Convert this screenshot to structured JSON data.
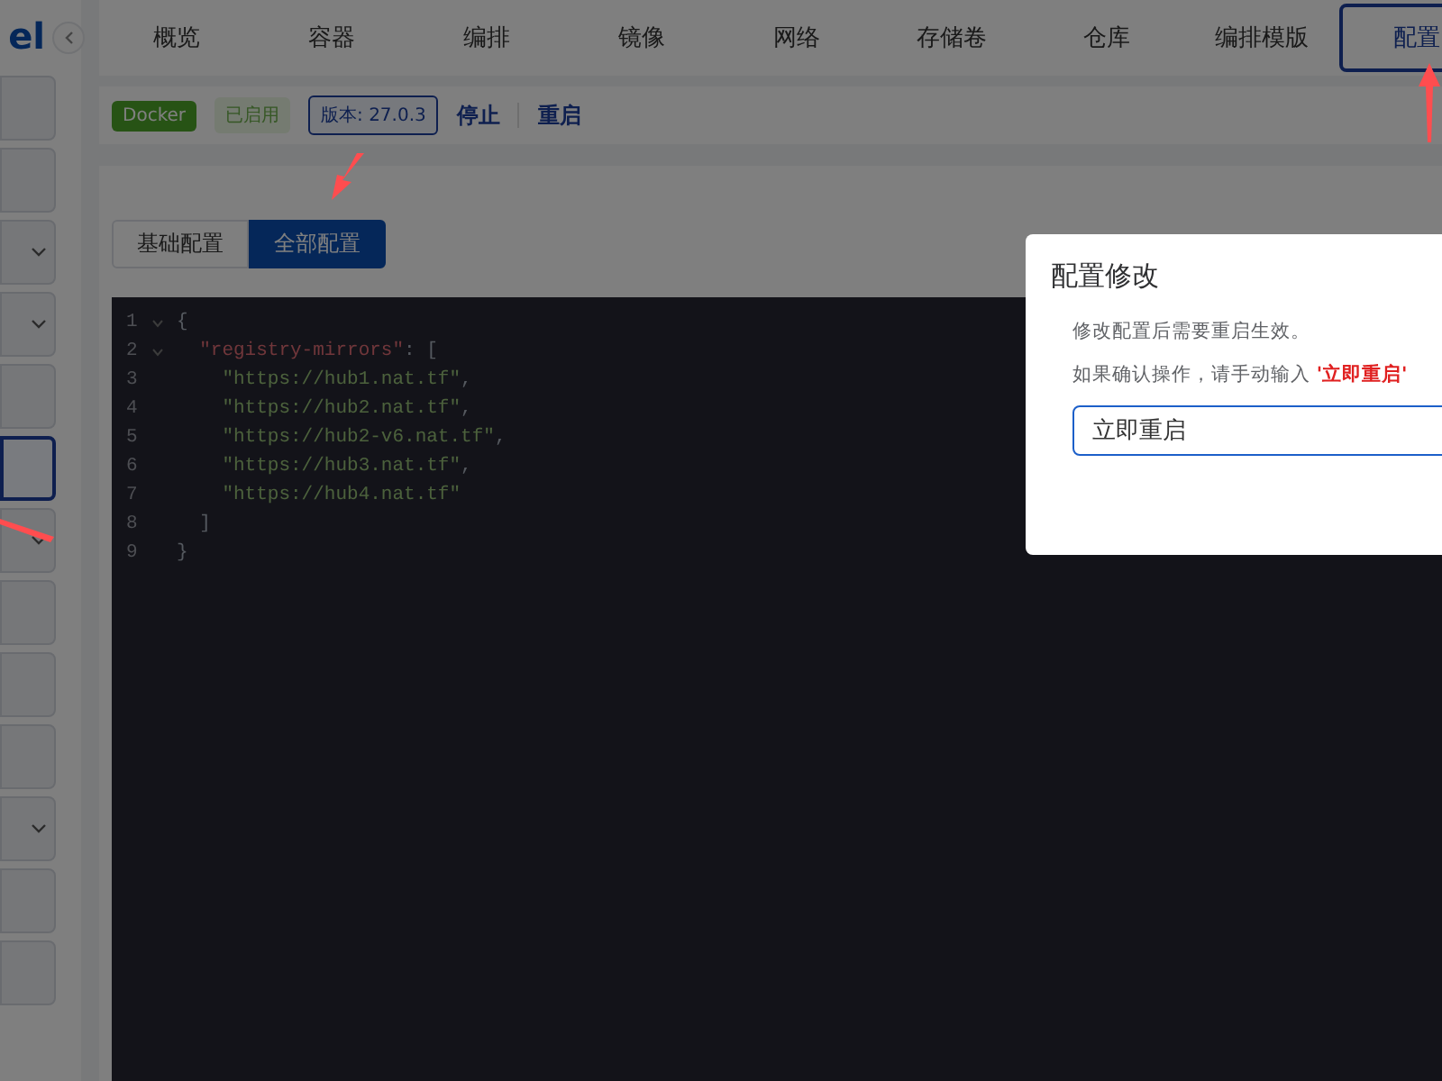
{
  "logo_text": "el",
  "sidebar": {
    "items": [
      {
        "selected": false,
        "expandable": false
      },
      {
        "selected": false,
        "expandable": false
      },
      {
        "selected": false,
        "expandable": true
      },
      {
        "selected": false,
        "expandable": true
      },
      {
        "selected": false,
        "expandable": false
      },
      {
        "selected": true,
        "expandable": false
      },
      {
        "selected": false,
        "expandable": true
      },
      {
        "selected": false,
        "expandable": false
      },
      {
        "selected": false,
        "expandable": false
      },
      {
        "selected": false,
        "expandable": false
      },
      {
        "selected": false,
        "expandable": true
      },
      {
        "selected": false,
        "expandable": false
      },
      {
        "selected": false,
        "expandable": false
      }
    ]
  },
  "tabs": [
    {
      "label": "概览",
      "selected": false
    },
    {
      "label": "容器",
      "selected": false
    },
    {
      "label": "编排",
      "selected": false
    },
    {
      "label": "镜像",
      "selected": false
    },
    {
      "label": "网络",
      "selected": false
    },
    {
      "label": "存储卷",
      "selected": false
    },
    {
      "label": "仓库",
      "selected": false
    },
    {
      "label": "编排模版",
      "selected": false
    },
    {
      "label": "配置",
      "selected": true
    }
  ],
  "status_bar": {
    "tags": [
      {
        "text": "Docker",
        "kind": "solid"
      },
      {
        "text": "已启用",
        "kind": "light"
      },
      {
        "text": "版本: 27.0.3",
        "kind": "outline"
      }
    ],
    "links": [
      "停止",
      "重启"
    ]
  },
  "mode_buttons": [
    {
      "label": "基础配置",
      "selected": false
    },
    {
      "label": "全部配置",
      "selected": true
    }
  ],
  "editor": {
    "lines": [
      {
        "number": "1",
        "foldable": true,
        "parts": [
          {
            "kind": "punct",
            "text": "{"
          }
        ]
      },
      {
        "number": "2",
        "foldable": true,
        "parts": [
          {
            "kind": "key",
            "text": "  \"registry-mirrors\""
          },
          {
            "kind": "punct",
            "text": ": ["
          }
        ]
      },
      {
        "number": "3",
        "foldable": false,
        "parts": [
          {
            "kind": "string",
            "text": "    \"https://hub1.nat.tf\""
          },
          {
            "kind": "punct",
            "text": ","
          }
        ]
      },
      {
        "number": "4",
        "foldable": false,
        "parts": [
          {
            "kind": "string",
            "text": "    \"https://hub2.nat.tf\""
          },
          {
            "kind": "punct",
            "text": ","
          }
        ]
      },
      {
        "number": "5",
        "foldable": false,
        "parts": [
          {
            "kind": "string",
            "text": "    \"https://hub2-v6.nat.tf\""
          },
          {
            "kind": "punct",
            "text": ","
          }
        ]
      },
      {
        "number": "6",
        "foldable": false,
        "parts": [
          {
            "kind": "string",
            "text": "    \"https://hub3.nat.tf\""
          },
          {
            "kind": "punct",
            "text": ","
          }
        ]
      },
      {
        "number": "7",
        "foldable": false,
        "parts": [
          {
            "kind": "string",
            "text": "    \"https://hub4.nat.tf\""
          }
        ]
      },
      {
        "number": "8",
        "foldable": false,
        "parts": [
          {
            "kind": "punct",
            "text": "  ]"
          }
        ]
      },
      {
        "number": "9",
        "foldable": false,
        "parts": [
          {
            "kind": "punct",
            "text": "}"
          }
        ]
      }
    ]
  },
  "dialog": {
    "title": "配置修改",
    "lines": [
      "修改配置后需要重启生效。",
      "如果确认操作，请手动输入 **'立即重启'**"
    ],
    "input": {
      "value": "立即重启"
    }
  }
}
